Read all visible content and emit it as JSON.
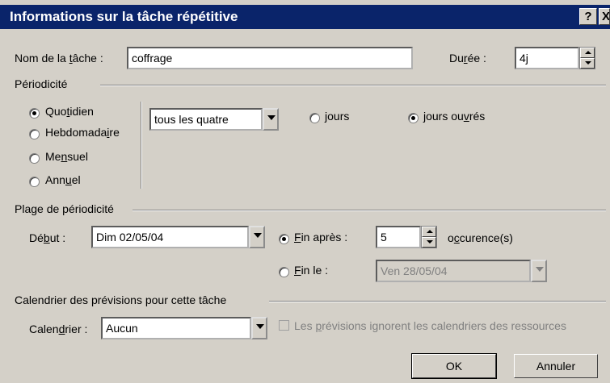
{
  "dialog": {
    "title": "Informations sur la tâche répétitive",
    "help_button": "?",
    "close_button": "X"
  },
  "task": {
    "name_label": "Nom de la tâche :",
    "name_value": "coffrage",
    "duration_label": "Durée :",
    "duration_value": "4j"
  },
  "periodicity": {
    "group_label": "Périodicité",
    "options": [
      "Quotidien",
      "Hebdomadaire",
      "Mensuel",
      "Annuel"
    ],
    "selected": "Quotidien",
    "frequency_value": "tous les quatre",
    "unit_days": "jours",
    "unit_workdays": "jours ouvrés",
    "unit_selected": "jours ouvrés"
  },
  "range": {
    "group_label": "Plage de périodicité",
    "start_label": "Début :",
    "start_value": "Dim 02/05/04",
    "end_after_label": "Fin après :",
    "end_after_value": "5",
    "occurrences_label": "occurence(s)",
    "end_on_label": "Fin le :",
    "end_on_value": "Ven 28/05/04",
    "end_selected": "Fin après"
  },
  "calendar": {
    "group_label": "Calendrier des prévisions pour cette tâche",
    "calendar_label": "Calendrier :",
    "calendar_value": "Aucun",
    "ignore_label": "Les prévisions ignorent les calendriers des ressources",
    "ignore_checked": false
  },
  "buttons": {
    "ok": "OK",
    "cancel": "Annuler"
  }
}
